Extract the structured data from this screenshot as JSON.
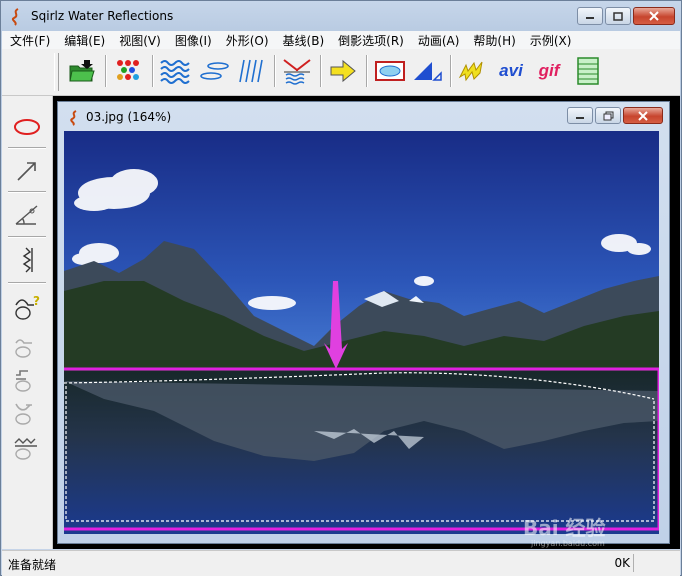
{
  "app": {
    "title": "Sqirlz Water Reflections"
  },
  "menu": [
    "文件(F)",
    "编辑(E)",
    "视图(V)",
    "图像(I)",
    "外形(O)",
    "基线(B)",
    "倒影选项(R)",
    "动画(A)",
    "帮助(H)",
    "示例(X)"
  ],
  "toolbar": {
    "avi_label": "avi",
    "gif_label": "gif"
  },
  "child": {
    "title": "03.jpg   (164%)"
  },
  "status": {
    "left": "准备就绪",
    "right": "0K"
  },
  "watermark": {
    "text": "Bai 经验",
    "sub": "jingyan.baidu.com"
  },
  "colors": {
    "selection_box": "#e020e0",
    "arrow": "#e040e0",
    "sky_top": "#1a2f8c",
    "sky_bottom": "#3d6fc8"
  }
}
